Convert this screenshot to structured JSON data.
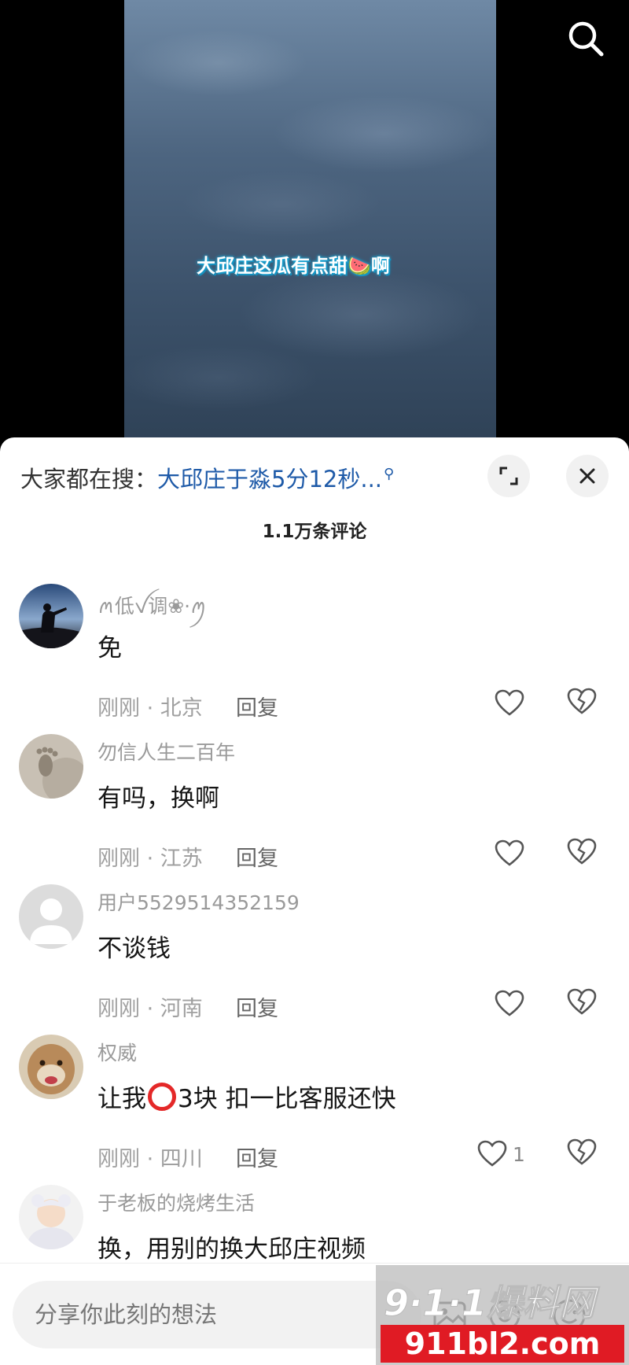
{
  "video": {
    "caption": "大邱庄这瓜有点甜🍉啊"
  },
  "sheet": {
    "trending_label": "大家都在搜：",
    "trending_query": "大邱庄于淼5分12秒...",
    "comment_count": "1.1万条评论"
  },
  "comments": [
    {
      "user": "ꪔ低ꪜ调❀·ꪑ",
      "text": "免",
      "time_loc": "刚刚 · 北京",
      "reply": "回复",
      "likes": ""
    },
    {
      "user": "勿信人生二百年",
      "text": "有吗，换啊",
      "time_loc": "刚刚 · 江苏",
      "reply": "回复",
      "likes": ""
    },
    {
      "user": "用户5529514352159",
      "text": "不谈钱",
      "time_loc": "刚刚 · 河南",
      "reply": "回复",
      "likes": ""
    },
    {
      "user": "权威",
      "text_before": "让我",
      "text_after": "3块 扣一比客服还快",
      "time_loc": "刚刚 · 四川",
      "reply": "回复",
      "likes": "1"
    },
    {
      "user": "于老板的烧烤生活",
      "text": "换，用别的换大邱庄视频"
    }
  ],
  "input": {
    "placeholder": "分享你此刻的想法"
  },
  "watermark": {
    "brand": "9·1·1爆料网",
    "domain": "911bl2.com"
  }
}
